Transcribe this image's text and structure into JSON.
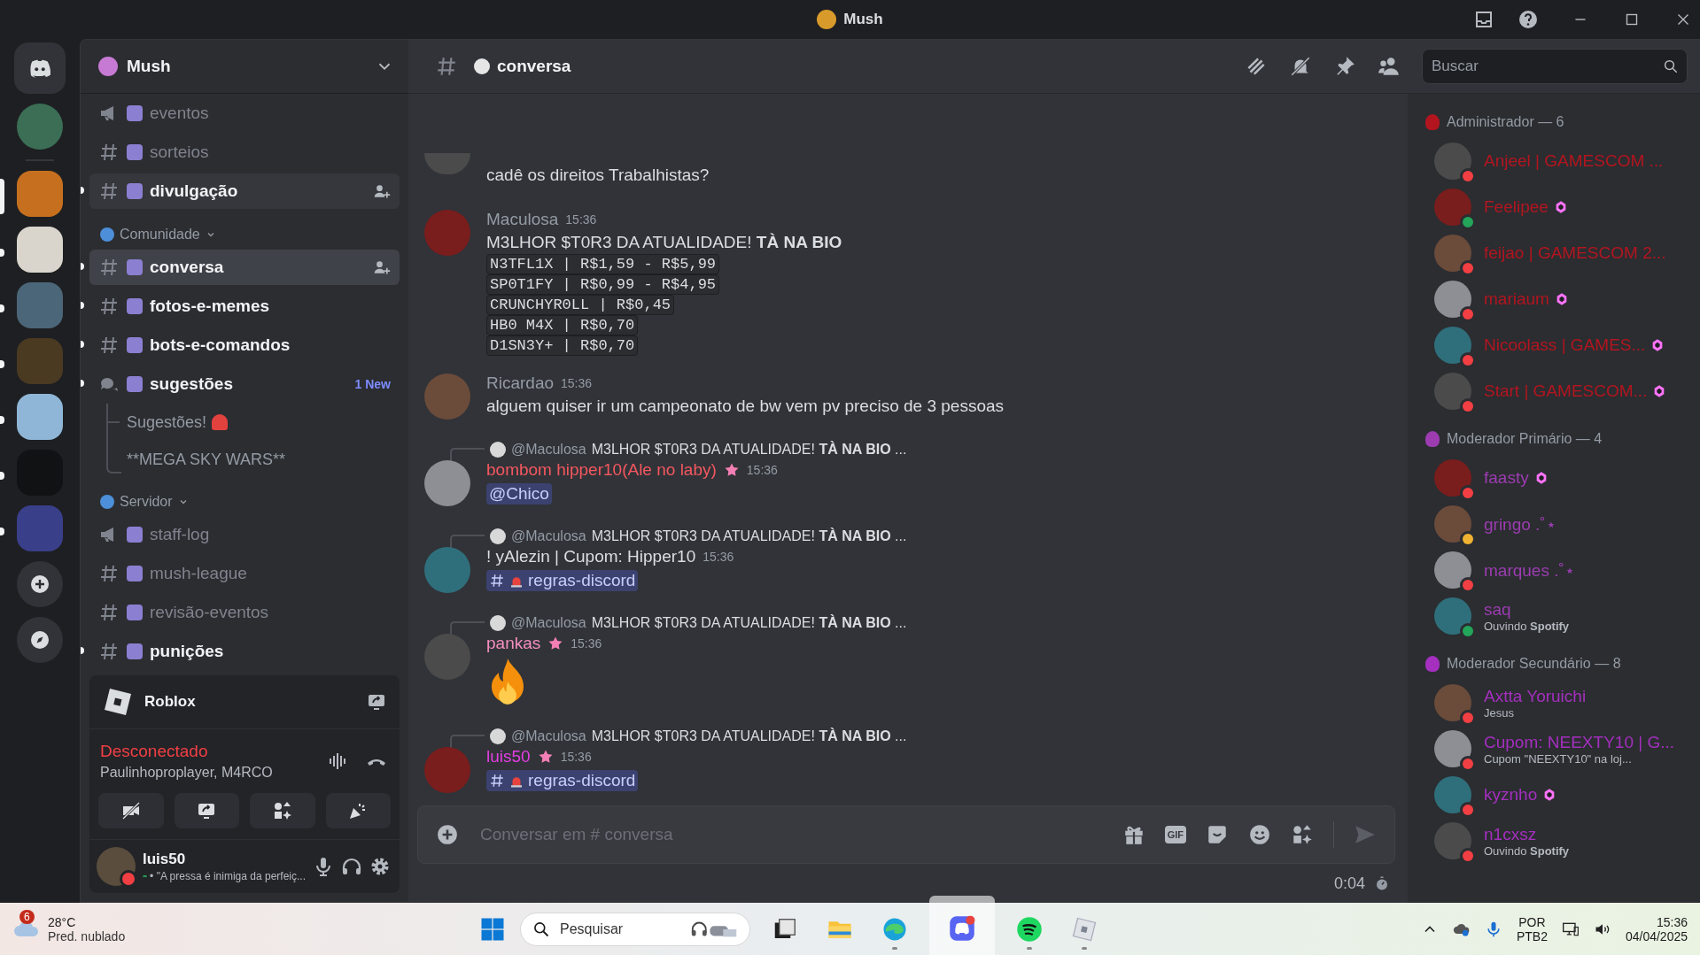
{
  "window": {
    "title": "Mush"
  },
  "servers": [
    {
      "selected": false,
      "unread": false
    },
    {
      "selected": true,
      "unread": false
    },
    {
      "selected": false,
      "unread": true
    },
    {
      "selected": false,
      "unread": true
    },
    {
      "selected": false,
      "unread": true
    },
    {
      "selected": false,
      "unread": true
    },
    {
      "selected": false,
      "unread": true
    },
    {
      "selected": false,
      "unread": true
    }
  ],
  "server_name": "Mush",
  "channels": [
    {
      "kind": "announcement",
      "name": "eventos",
      "unread": false,
      "selected": false,
      "highlighted": false
    },
    {
      "kind": "text",
      "name": "sorteios",
      "unread": false,
      "selected": false,
      "highlighted": false
    },
    {
      "kind": "text",
      "name": "divulgação",
      "unread": true,
      "selected": false,
      "highlighted": true
    },
    {
      "kind": "category",
      "name": "Comunidade"
    },
    {
      "kind": "text",
      "name": "conversa",
      "unread": true,
      "selected": true,
      "highlighted": false
    },
    {
      "kind": "text",
      "name": "fotos-e-memes",
      "unread": true,
      "selected": false,
      "highlighted": false
    },
    {
      "kind": "text",
      "name": "bots-e-comandos",
      "unread": true,
      "selected": false,
      "highlighted": false
    },
    {
      "kind": "forum",
      "name": "sugestões",
      "unread": true,
      "selected": false,
      "highlighted": false,
      "badge": "1 New",
      "children": [
        {
          "name": "Sugestões!"
        },
        {
          "name": "**MEGA SKY WARS**"
        }
      ]
    },
    {
      "kind": "category",
      "name": "Servidor"
    },
    {
      "kind": "announcement",
      "name": "staff-log",
      "unread": false,
      "selected": false,
      "highlighted": false
    },
    {
      "kind": "text",
      "name": "mush-league",
      "unread": false,
      "selected": false,
      "highlighted": false
    },
    {
      "kind": "text",
      "name": "revisão-eventos",
      "unread": false,
      "selected": false,
      "highlighted": false
    },
    {
      "kind": "text",
      "name": "punições",
      "unread": true,
      "selected": false,
      "highlighted": false
    }
  ],
  "activity": {
    "name": "Roblox"
  },
  "voice": {
    "status": "Desconectado",
    "members": "Paulinhoproplayer, M4RCO"
  },
  "user": {
    "name": "luis50",
    "status_text": "• \"A pressa é inimiga da perfeiç..."
  },
  "chat_header": {
    "channel": "conversa"
  },
  "search": {
    "placeholder": "Buscar"
  },
  "messages": [
    {
      "blocks": [
        {
          "kind": "text",
          "text": "cadê os direitos Trabalhistas?"
        }
      ]
    },
    {
      "author": "Maculosa",
      "color": "#949ba4",
      "role_icon": false,
      "time": "15:36",
      "blocks": [
        {
          "kind": "text",
          "text": "M3LHOR $T0R3 DA ATUALIDADE! **TÀ NA BIO**"
        },
        {
          "kind": "code",
          "text": "N3TFL1X | R$1,59 - R$5,99"
        },
        {
          "kind": "code",
          "text": "SP0T1FY | R$0,99 - R$4,95"
        },
        {
          "kind": "code",
          "text": "CRUNCHYR0LL | R$0,45"
        },
        {
          "kind": "code",
          "text": "HB0 M4X | R$0,70"
        },
        {
          "kind": "code",
          "text": "D1SN3Y+ | R$0,70"
        }
      ]
    },
    {
      "author": "Ricardao",
      "color": "#949ba4",
      "role_icon": false,
      "time": "15:36",
      "blocks": [
        {
          "kind": "text",
          "text": "alguem quiser ir um campeonato de bw vem pv preciso de 3 pessoas"
        }
      ]
    },
    {
      "reply": {
        "to": "@Maculosa",
        "text": "M3LHOR $T0R3 DA ATUALIDADE! **TÀ NA BIO** ..."
      },
      "author": "bombom hipper10(Ale no laby)",
      "color": "#f5575f",
      "role_icon": true,
      "time": "15:36",
      "blocks": [
        {
          "kind": "mention",
          "text": "@Chico"
        }
      ]
    },
    {
      "reply": {
        "to": "@Maculosa",
        "text": "M3LHOR $T0R3 DA ATUALIDADE! **TÀ NA BIO** ..."
      },
      "author": "! yAlezin | Cupom: Hipper10",
      "color": "#dbdee1",
      "role_icon": false,
      "time": "15:36",
      "blocks": [
        {
          "kind": "channel",
          "text": "regras-discord"
        }
      ]
    },
    {
      "reply": {
        "to": "@Maculosa",
        "text": "M3LHOR $T0R3 DA ATUALIDADE! **TÀ NA BIO** ..."
      },
      "author": "pankas",
      "color": "#f58fbf",
      "role_icon": true,
      "time": "15:36",
      "blocks": [
        {
          "kind": "emoji"
        }
      ]
    },
    {
      "reply": {
        "to": "@Maculosa",
        "text": "M3LHOR $T0R3 DA ATUALIDADE! **TÀ NA BIO** ..."
      },
      "author": "luis50",
      "color": "#e43ee4",
      "role_icon": true,
      "time": "15:36",
      "blocks": [
        {
          "kind": "channel",
          "text": "regras-discord"
        }
      ]
    }
  ],
  "composer": {
    "placeholder": "Conversar em # conversa",
    "gif_label": "GIF",
    "timer": "0:04"
  },
  "member_groups": [
    {
      "name": "Administrador — 6",
      "color": "#b3151f",
      "members": [
        {
          "name": "Anjeel | GAMESCOM ...",
          "color": "#f23f43",
          "boosting": false
        },
        {
          "name": "Feelipee",
          "color": "#23a55a",
          "boosting": true
        },
        {
          "name": "feijao | GAMESCOM 2...",
          "color": "#f23f43",
          "boosting": false
        },
        {
          "name": "mariaum",
          "color": "#f23f43",
          "boosting": true
        },
        {
          "name": "Nicoolass | GAMES...",
          "color": "#f23f43",
          "boosting": true
        },
        {
          "name": "Start | GAMESCOM...",
          "color": "#f23f43",
          "boosting": true
        }
      ]
    },
    {
      "name": "Moderador Primário — 4",
      "color": "#9c3cb0",
      "members": [
        {
          "name": "faasty",
          "color": "#f23f43",
          "boosting": true
        },
        {
          "name": "gringo .˚⋆",
          "color": "#f0b232",
          "boosting": false
        },
        {
          "name": "marques .˚⋆",
          "color": "#f23f43",
          "boosting": false
        },
        {
          "name": "saq",
          "color": "#23a55a",
          "boosting": false,
          "activity": "Ouvindo **Spotify**"
        }
      ]
    },
    {
      "name": "Moderador Secundário — 8",
      "color": "#a52fbf",
      "members": [
        {
          "name": "Axtta Yoruichi",
          "color": "#f23f43",
          "boosting": false,
          "activity": "Jesus"
        },
        {
          "name": "Cupom: NEEXTY10 | G...",
          "color": "#f23f43",
          "boosting": false,
          "activity": "Cupom \"NEEXTY10\" na loj..."
        },
        {
          "name": "kyznho",
          "color": "#f23f43",
          "boosting": true
        },
        {
          "name": "n1cxsz",
          "color": "#f23f43",
          "boosting": false,
          "activity": "Ouvindo **Spotify**"
        }
      ]
    }
  ],
  "taskbar": {
    "weather": {
      "badge": "6",
      "temperature": "28°C",
      "condition": "Pred. nublado"
    },
    "search_placeholder": "Pesquisar",
    "apps": [
      {
        "kind": "taskview",
        "running": false,
        "active": false
      },
      {
        "kind": "explorer",
        "running": false,
        "active": false
      },
      {
        "kind": "edge",
        "running": true,
        "active": false
      },
      {
        "kind": "discord",
        "running": true,
        "active": true
      },
      {
        "kind": "spotify",
        "running": true,
        "active": false
      },
      {
        "kind": "roblox",
        "running": true,
        "active": false
      }
    ],
    "language": "POR",
    "layout": "PTB2",
    "time": "15:36",
    "date": "04/04/2025"
  }
}
